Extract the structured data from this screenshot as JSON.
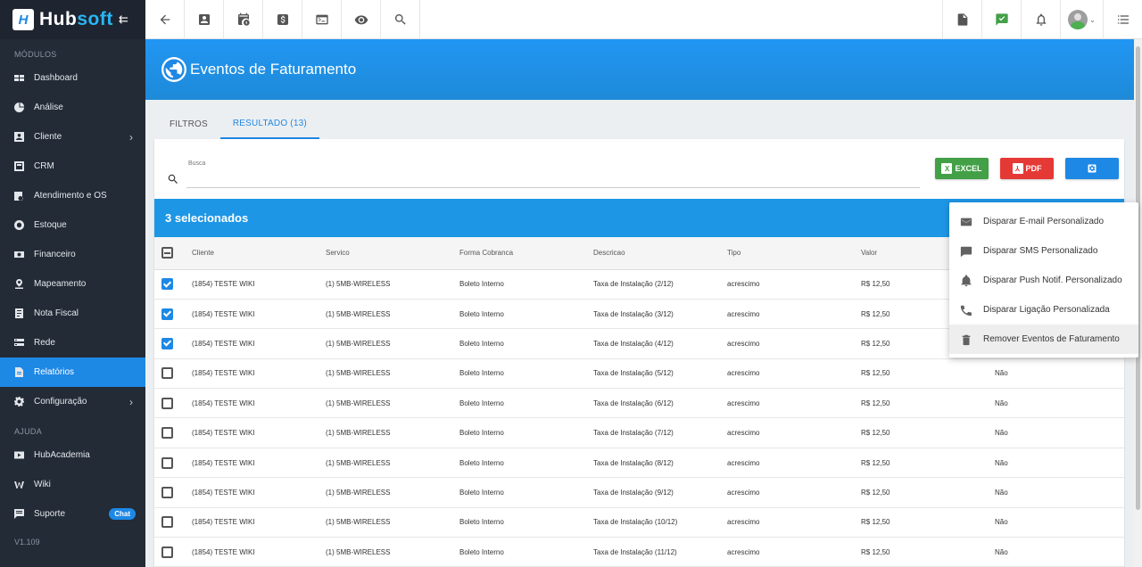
{
  "app": {
    "name_a": "Hub",
    "name_b": "soft",
    "logo_letter": "H",
    "collapse_icon": "collapse-menu-icon"
  },
  "sidebar": {
    "modules_label": "MÓDULOS",
    "items": [
      {
        "label": "Dashboard",
        "icon": "dashboard-icon"
      },
      {
        "label": "Análise",
        "icon": "analytics-icon"
      },
      {
        "label": "Cliente",
        "icon": "client-icon",
        "has_submenu": true
      },
      {
        "label": "CRM",
        "icon": "crm-icon"
      },
      {
        "label": "Atendimento e OS",
        "icon": "service-order-icon"
      },
      {
        "label": "Estoque",
        "icon": "stock-icon"
      },
      {
        "label": "Financeiro",
        "icon": "finance-icon"
      },
      {
        "label": "Mapeamento",
        "icon": "map-pin-icon"
      },
      {
        "label": "Nota Fiscal",
        "icon": "invoice-icon"
      },
      {
        "label": "Rede",
        "icon": "network-icon"
      },
      {
        "label": "Relatórios",
        "icon": "reports-icon",
        "active": true
      },
      {
        "label": "Configuração",
        "icon": "settings-icon",
        "has_submenu": true
      }
    ],
    "help_label": "AJUDA",
    "help_items": [
      {
        "label": "HubAcademia",
        "icon": "play-icon"
      },
      {
        "label": "Wiki",
        "icon": "wiki-icon"
      },
      {
        "label": "Suporte",
        "icon": "support-icon",
        "badge": "Chat"
      }
    ],
    "version": "V1.109"
  },
  "page": {
    "title": "Eventos de Faturamento"
  },
  "tabs": [
    {
      "label": "FILTROS",
      "active": false
    },
    {
      "label": "RESULTADO (13)",
      "active": true
    }
  ],
  "search": {
    "label": "Busca",
    "value": ""
  },
  "buttons": {
    "excel": "EXCEL",
    "pdf": "PDF"
  },
  "selection": {
    "text": "3 selecionados"
  },
  "table": {
    "headers": [
      "Cliente",
      "Servico",
      "Forma Cobranca",
      "Descricao",
      "Tipo",
      "Valor"
    ],
    "rows": [
      {
        "checked": true,
        "cliente": "(1854) TESTE WIKI",
        "servico": "(1) 5MB-WIRELESS",
        "forma": "Boleto Interno",
        "descricao": "Taxa de Instalação (2/12)",
        "tipo": "acrescimo",
        "valor": "R$ 12,50",
        "extra": ""
      },
      {
        "checked": true,
        "cliente": "(1854) TESTE WIKI",
        "servico": "(1) 5MB-WIRELESS",
        "forma": "Boleto Interno",
        "descricao": "Taxa de Instalação (3/12)",
        "tipo": "acrescimo",
        "valor": "R$ 12,50",
        "extra": ""
      },
      {
        "checked": true,
        "cliente": "(1854) TESTE WIKI",
        "servico": "(1) 5MB-WIRELESS",
        "forma": "Boleto Interno",
        "descricao": "Taxa de Instalação (4/12)",
        "tipo": "acrescimo",
        "valor": "R$ 12,50",
        "extra": ""
      },
      {
        "checked": false,
        "cliente": "(1854) TESTE WIKI",
        "servico": "(1) 5MB-WIRELESS",
        "forma": "Boleto Interno",
        "descricao": "Taxa de Instalação (5/12)",
        "tipo": "acrescimo",
        "valor": "R$ 12,50",
        "extra": "Não"
      },
      {
        "checked": false,
        "cliente": "(1854) TESTE WIKI",
        "servico": "(1) 5MB-WIRELESS",
        "forma": "Boleto Interno",
        "descricao": "Taxa de Instalação (6/12)",
        "tipo": "acrescimo",
        "valor": "R$ 12,50",
        "extra": "Não"
      },
      {
        "checked": false,
        "cliente": "(1854) TESTE WIKI",
        "servico": "(1) 5MB-WIRELESS",
        "forma": "Boleto Interno",
        "descricao": "Taxa de Instalação (7/12)",
        "tipo": "acrescimo",
        "valor": "R$ 12,50",
        "extra": "Não"
      },
      {
        "checked": false,
        "cliente": "(1854) TESTE WIKI",
        "servico": "(1) 5MB-WIRELESS",
        "forma": "Boleto Interno",
        "descricao": "Taxa de Instalação (8/12)",
        "tipo": "acrescimo",
        "valor": "R$ 12,50",
        "extra": "Não"
      },
      {
        "checked": false,
        "cliente": "(1854) TESTE WIKI",
        "servico": "(1) 5MB-WIRELESS",
        "forma": "Boleto Interno",
        "descricao": "Taxa de Instalação (9/12)",
        "tipo": "acrescimo",
        "valor": "R$ 12,50",
        "extra": "Não"
      },
      {
        "checked": false,
        "cliente": "(1854) TESTE WIKI",
        "servico": "(1) 5MB-WIRELESS",
        "forma": "Boleto Interno",
        "descricao": "Taxa de Instalação (10/12)",
        "tipo": "acrescimo",
        "valor": "R$ 12,50",
        "extra": "Não"
      },
      {
        "checked": false,
        "cliente": "(1854) TESTE WIKI",
        "servico": "(1) 5MB-WIRELESS",
        "forma": "Boleto Interno",
        "descricao": "Taxa de Instalação (11/12)",
        "tipo": "acrescimo",
        "valor": "R$ 12,50",
        "extra": "Não"
      }
    ]
  },
  "context_menu": [
    {
      "label": "Disparar E-mail Personalizado",
      "icon": "email-icon"
    },
    {
      "label": "Disparar SMS Personalizado",
      "icon": "sms-icon"
    },
    {
      "label": "Disparar Push Notif. Personalizado",
      "icon": "bell-icon"
    },
    {
      "label": "Disparar Ligação Personalizada",
      "icon": "phone-icon"
    },
    {
      "label": "Remover Eventos de Faturamento",
      "icon": "trash-icon",
      "hover": true
    }
  ],
  "colors": {
    "primary": "#1e88e5",
    "sidebar": "#232b36",
    "excel": "#43a047",
    "pdf": "#e53935"
  }
}
